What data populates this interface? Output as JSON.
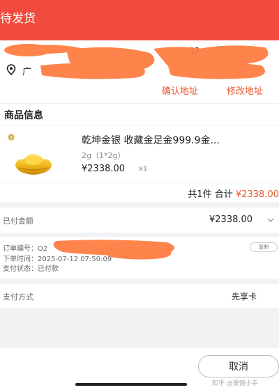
{
  "header": {
    "title": "待发货",
    "bg_color": "#f04b3e"
  },
  "address": {
    "name_fragment": "",
    "phone_fragment": "13",
    "address_fragment": "广",
    "pin_icon": "location-pin-icon",
    "confirm_label": "确认地址",
    "modify_label": "修改地址",
    "accent_color": "#e8572b"
  },
  "product_section": {
    "title": "商品信息",
    "shop_icon": "shop-logo-icon",
    "product": {
      "name": "乾坤金银 收藏金足金999.9金...",
      "spec": "2g（1*2g）",
      "price": "¥2338.00",
      "quantity": "x1"
    },
    "total": {
      "count_text": "共1件",
      "sum_label": "合计",
      "amount": "¥2338.00"
    }
  },
  "payment_amount": {
    "label": "已付金额",
    "value": "¥2338.00"
  },
  "order_info": {
    "order_no_label": "订单编号：",
    "order_no_value": "O2",
    "order_time_label": "下单时间：",
    "order_time_value": "2025-07-12 07:50:09",
    "pay_status_label": "支付状态：",
    "pay_status_value": "已付款",
    "copy_label": "复制"
  },
  "payment_method": {
    "label": "支付方式",
    "value": "先享卡"
  },
  "bottom": {
    "cancel_label": "取消",
    "watermark": "知乎 @爱情小手"
  }
}
